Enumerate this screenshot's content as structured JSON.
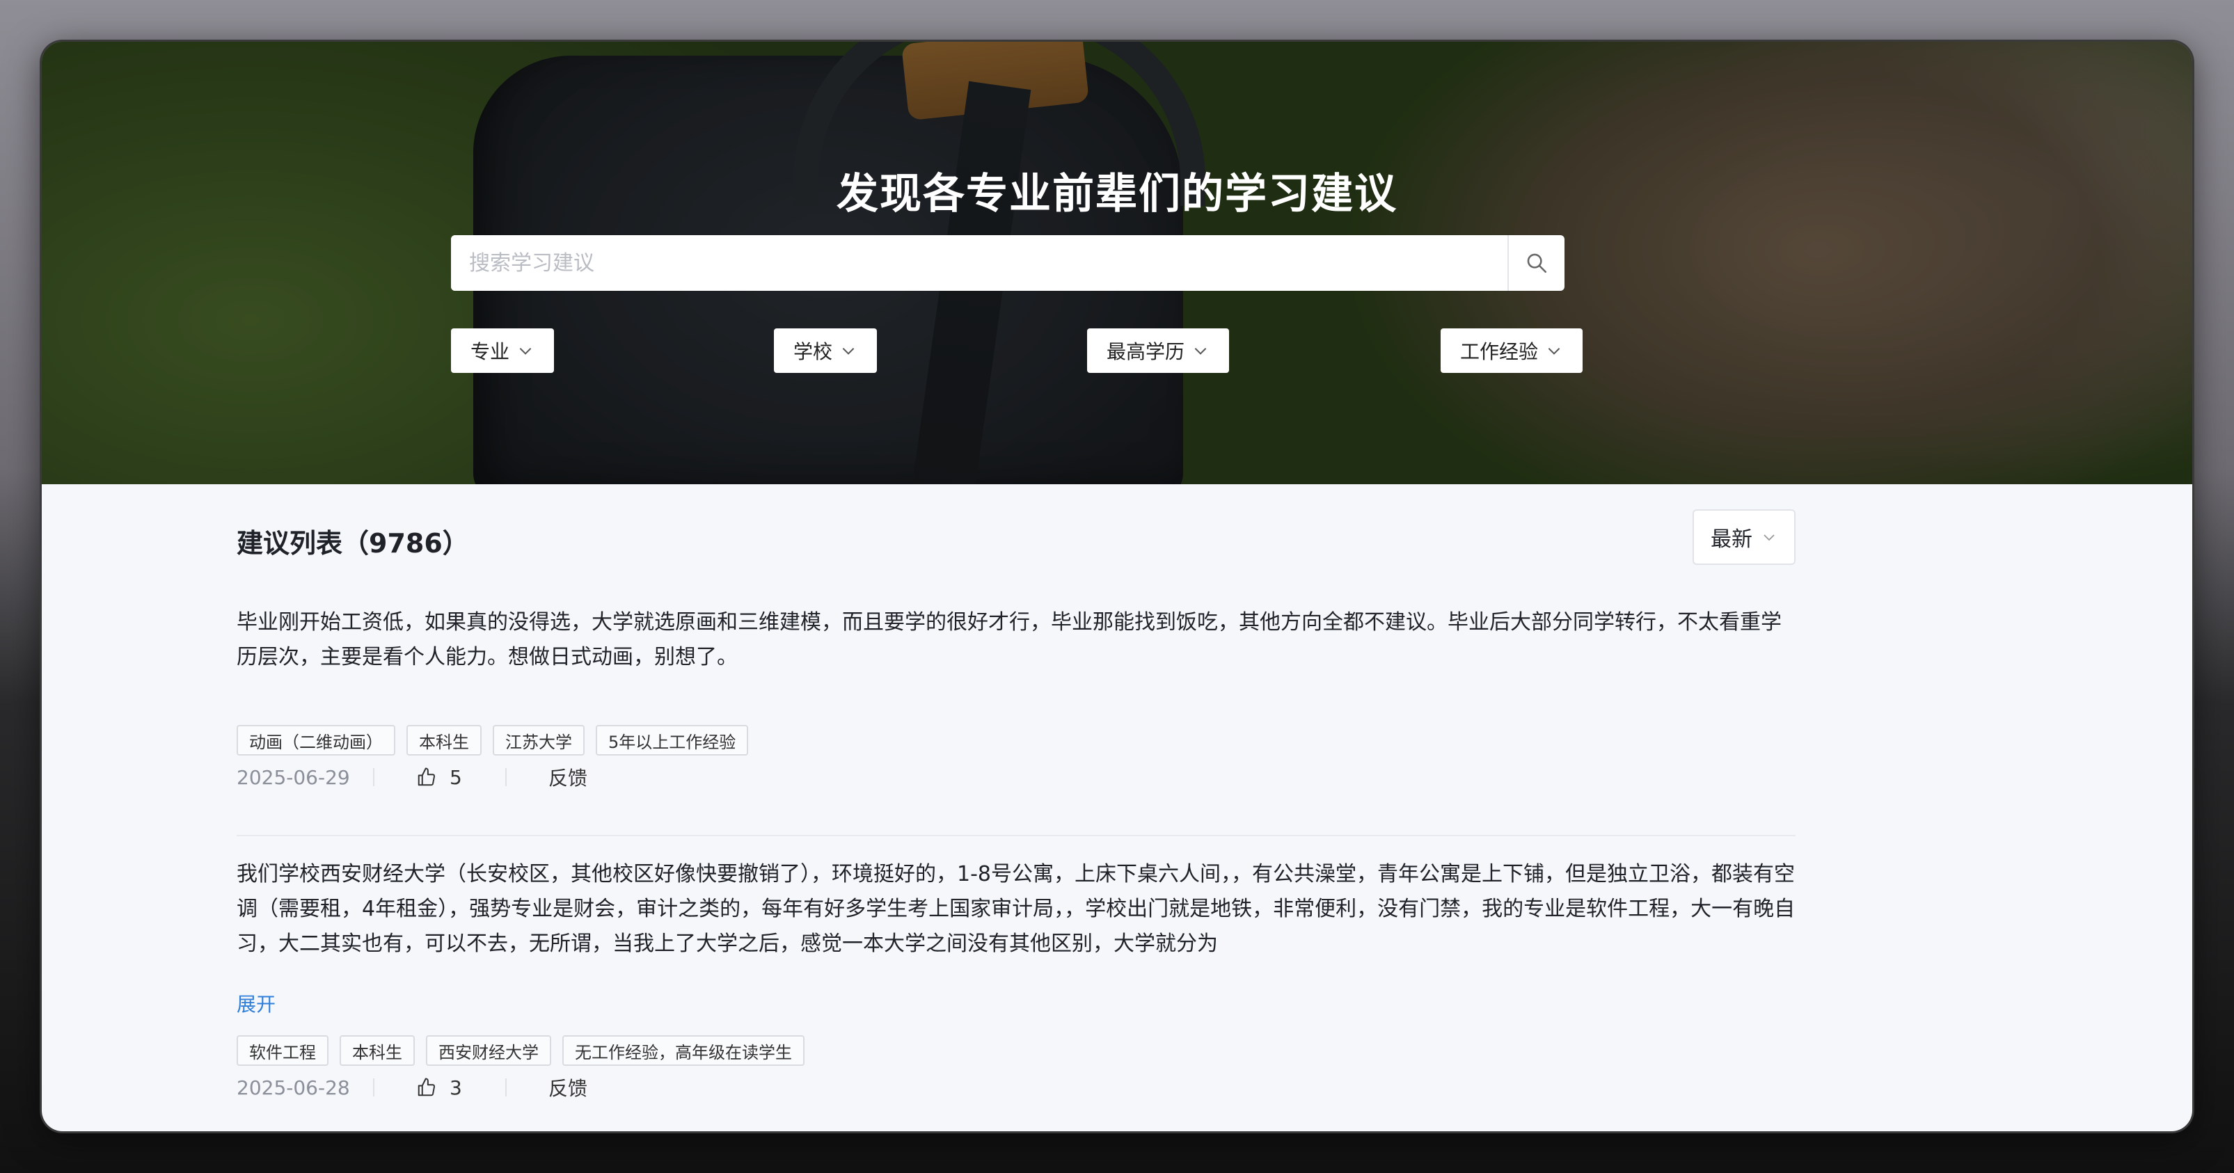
{
  "hero": {
    "title": "发现各专业前辈们的学习建议",
    "search_placeholder": "搜索学习建议",
    "search_icon": "search-icon",
    "filters": [
      "专业",
      "学校",
      "最高学历",
      "工作经验"
    ]
  },
  "list": {
    "title": "建议列表（9786）",
    "sort_label": "最新",
    "items": [
      {
        "text": "毕业刚开始工资低，如果真的没得选，大学就选原画和三维建模，而且要学的很好才行，毕业那能找到饭吃，其他方向全都不建议。毕业后大部分同学转行，不太看重学历层次，主要是看个人能力。想做日式动画，别想了。",
        "tags": [
          "动画（二维动画）",
          "本科生",
          "江苏大学",
          "5年以上工作经验"
        ],
        "date": "2025-06-29",
        "likes": "5",
        "feedback": "反馈"
      },
      {
        "text": "我们学校西安财经大学（长安校区，其他校区好像快要撤销了），环境挺好的，1-8号公寓，上床下桌六人间，，有公共澡堂，青年公寓是上下铺，但是独立卫浴，都装有空调（需要租，4年租金），强势专业是财会，审计之类的，每年有好多学生考上国家审计局，，学校出门就是地铁，非常便利，没有门禁，我的专业是软件工程，大一有晚自习，大二其实也有，可以不去，无所谓，当我上了大学之后，感觉一本大学之间没有其他区别，大学就分为",
        "expand": "展开",
        "tags": [
          "软件工程",
          "本科生",
          "西安财经大学",
          "无工作经验，高年级在读学生"
        ],
        "date": "2025-06-28",
        "likes": "3",
        "feedback": "反馈"
      }
    ]
  },
  "icons": {
    "like": "thumbs-up-icon",
    "chevron": "chevron-down-icon"
  }
}
